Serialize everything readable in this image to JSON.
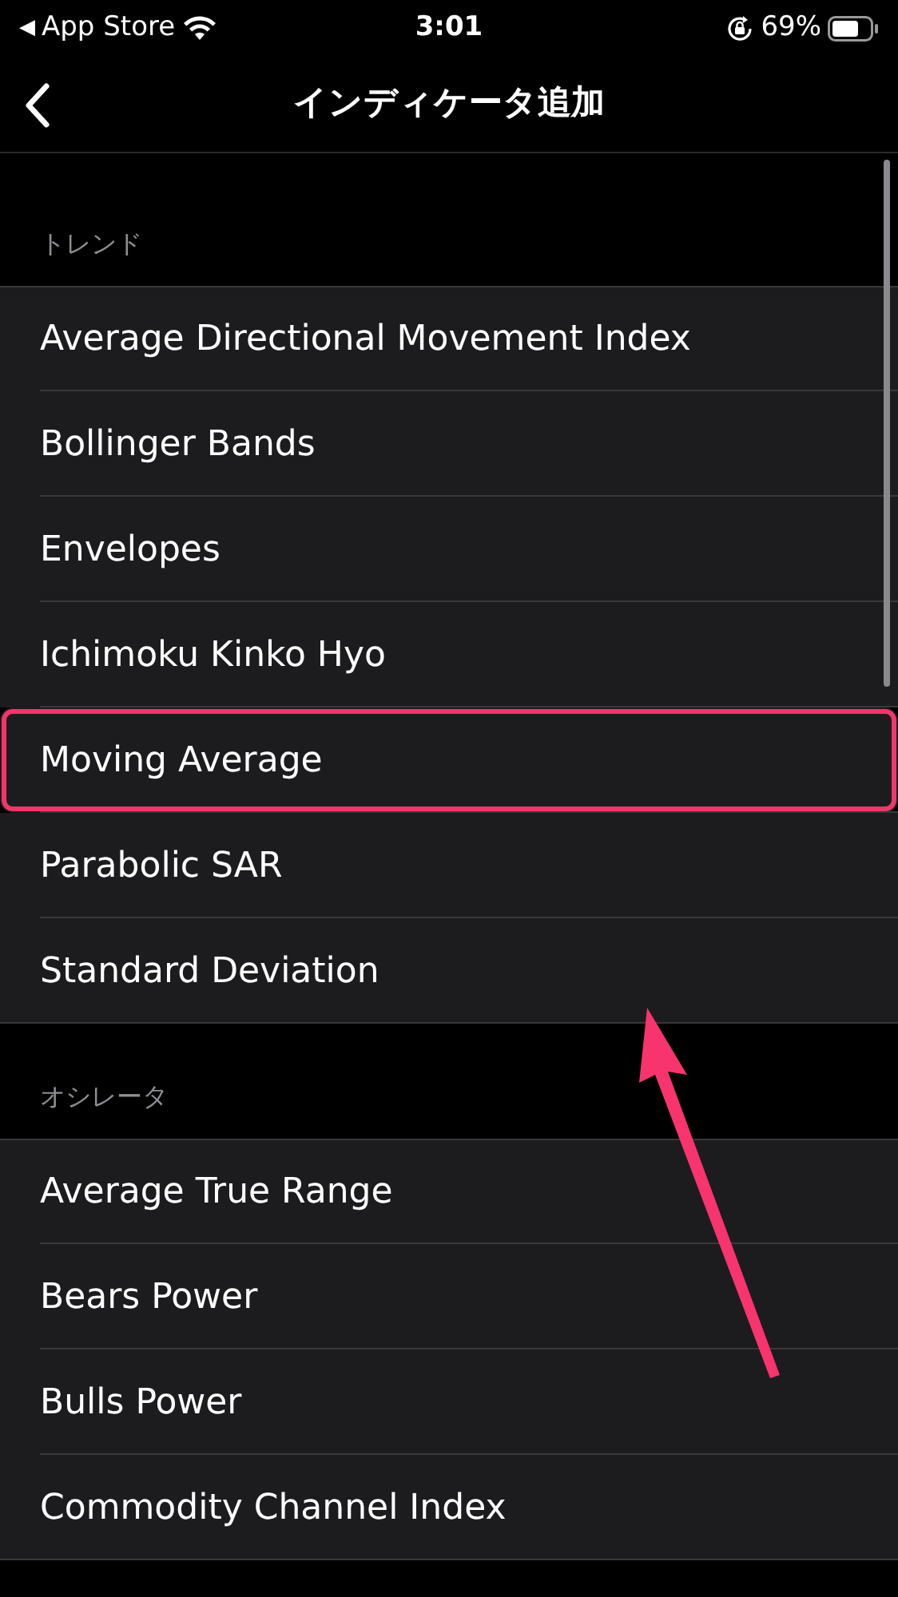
{
  "status_bar": {
    "back_glyph": "◀",
    "back_app": "App Store",
    "time": "3:01",
    "battery": "69%"
  },
  "nav": {
    "title": "インディケータ追加"
  },
  "sections": [
    {
      "header": "トレンド",
      "items": [
        {
          "label": "Average Directional Movement Index",
          "highlighted": false
        },
        {
          "label": "Bollinger Bands",
          "highlighted": false
        },
        {
          "label": "Envelopes",
          "highlighted": false
        },
        {
          "label": "Ichimoku Kinko Hyo",
          "highlighted": false
        },
        {
          "label": "Moving Average",
          "highlighted": true
        },
        {
          "label": "Parabolic SAR",
          "highlighted": false
        },
        {
          "label": "Standard Deviation",
          "highlighted": false
        }
      ]
    },
    {
      "header": "オシレータ",
      "items": [
        {
          "label": "Average True Range",
          "highlighted": false
        },
        {
          "label": "Bears Power",
          "highlighted": false
        },
        {
          "label": "Bulls Power",
          "highlighted": false
        },
        {
          "label": "Commodity Channel Index",
          "highlighted": false
        }
      ]
    }
  ]
}
